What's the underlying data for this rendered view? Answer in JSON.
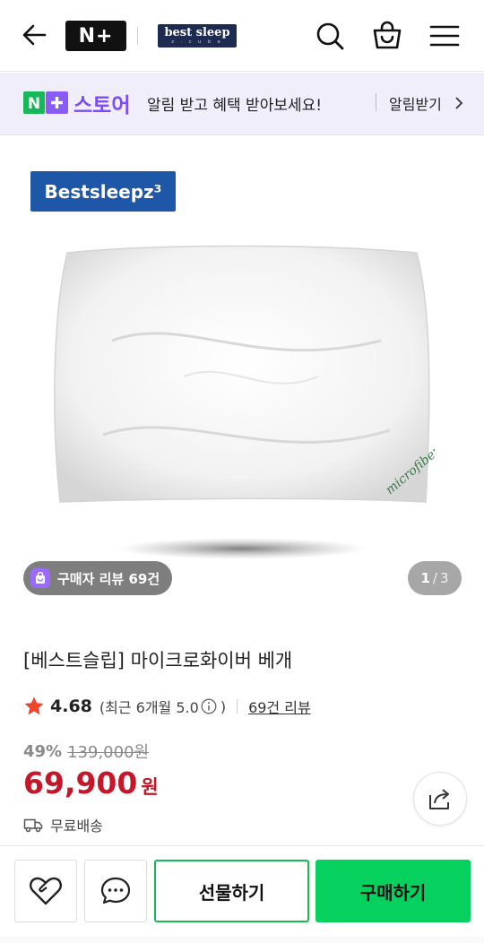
{
  "header": {
    "logo_text": "N+",
    "brand_logo_text": "best sleep",
    "brand_logo_sub": "z · c u b e",
    "icons": [
      "back-arrow-icon",
      "search-icon",
      "shopping-bag-icon",
      "menu-icon"
    ]
  },
  "store_banner": {
    "logo_text": "N+",
    "store_name": "스토어",
    "message": "알림 받고 혜택 받아보세요!",
    "link_label": "알림받기"
  },
  "gallery": {
    "brand_badge": "Bestsleepz³",
    "review_badge": "구매자 리뷰 69건",
    "current_page": "1",
    "total_pages": "3",
    "pillow_tag": "microfiber"
  },
  "product": {
    "title": "[베스트슬립] 마이크로화이버 베개",
    "rating": "4.68",
    "recent_rating": "(최근 6개월 5.0",
    "recent_close": ")",
    "review_link": "69건 리뷰",
    "discount_rate": "49%",
    "original_price": "139,000원",
    "sale_price": "69,900",
    "price_unit": "원",
    "shipping": "무료배송"
  },
  "actions": {
    "gift_label": "선물하기",
    "buy_label": "구매하기"
  },
  "colors": {
    "accent_green": "#06d15f",
    "price_red": "#c4182a",
    "store_purple": "#7b4ef0"
  }
}
